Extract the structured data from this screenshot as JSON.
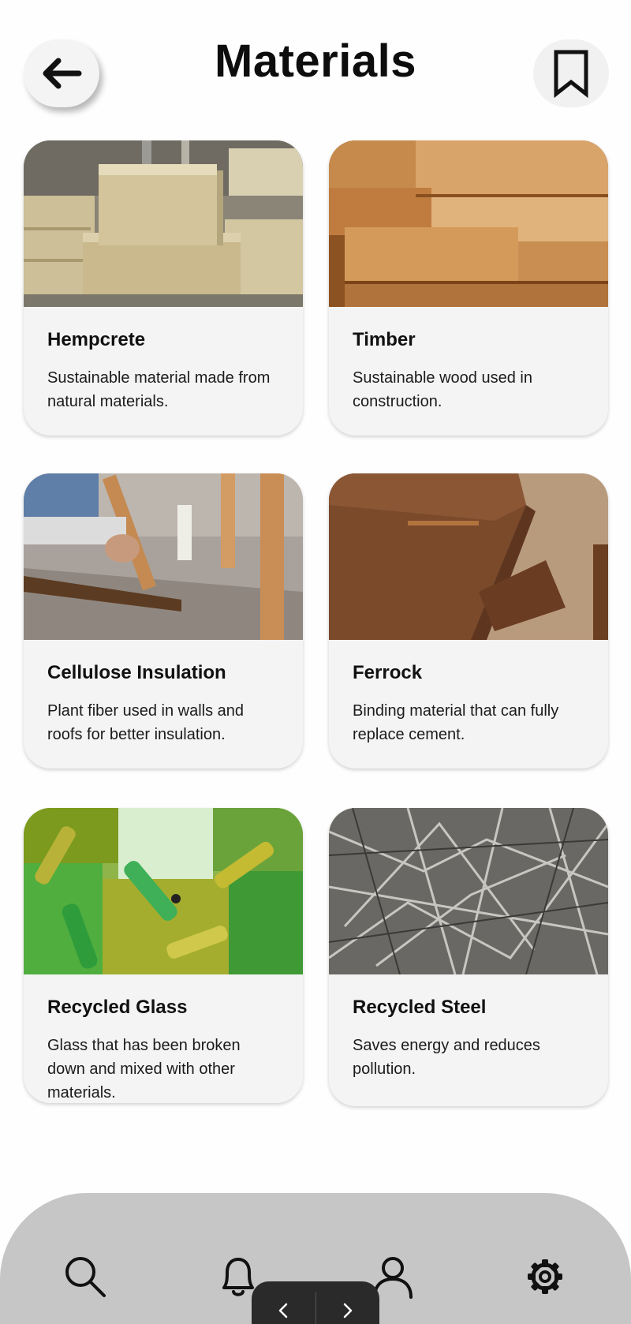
{
  "header": {
    "title": "Materials",
    "back_icon": "arrow-left-icon",
    "bookmark_icon": "bookmark-icon"
  },
  "materials": [
    {
      "title": "Hempcrete",
      "description": "Sustainable material made from natural materials.",
      "image": "hempcrete-blocks-photo"
    },
    {
      "title": "Timber",
      "description": "Sustainable wood used in construction.",
      "image": "timber-planks-photo"
    },
    {
      "title": "Cellulose Insulation",
      "description": "Plant fiber used in walls and roofs for better insulation.",
      "image": "cellulose-insulation-photo"
    },
    {
      "title": "Ferrock",
      "description": "Binding material that can fully replace cement.",
      "image": "ferrock-slabs-photo"
    },
    {
      "title": "Recycled Glass",
      "description": "Glass that has been broken down and mixed with other materials.",
      "image": "recycled-glass-bottles-photo"
    },
    {
      "title": "Recycled Steel",
      "description": "Saves energy and reduces pollution.",
      "image": "recycled-steel-scrap-photo"
    }
  ],
  "bottom_nav": {
    "items": [
      "search-icon",
      "bell-icon",
      "user-icon",
      "gear-icon"
    ]
  },
  "pager": {
    "prev_icon": "chevron-left-icon",
    "next_icon": "chevron-right-icon"
  }
}
